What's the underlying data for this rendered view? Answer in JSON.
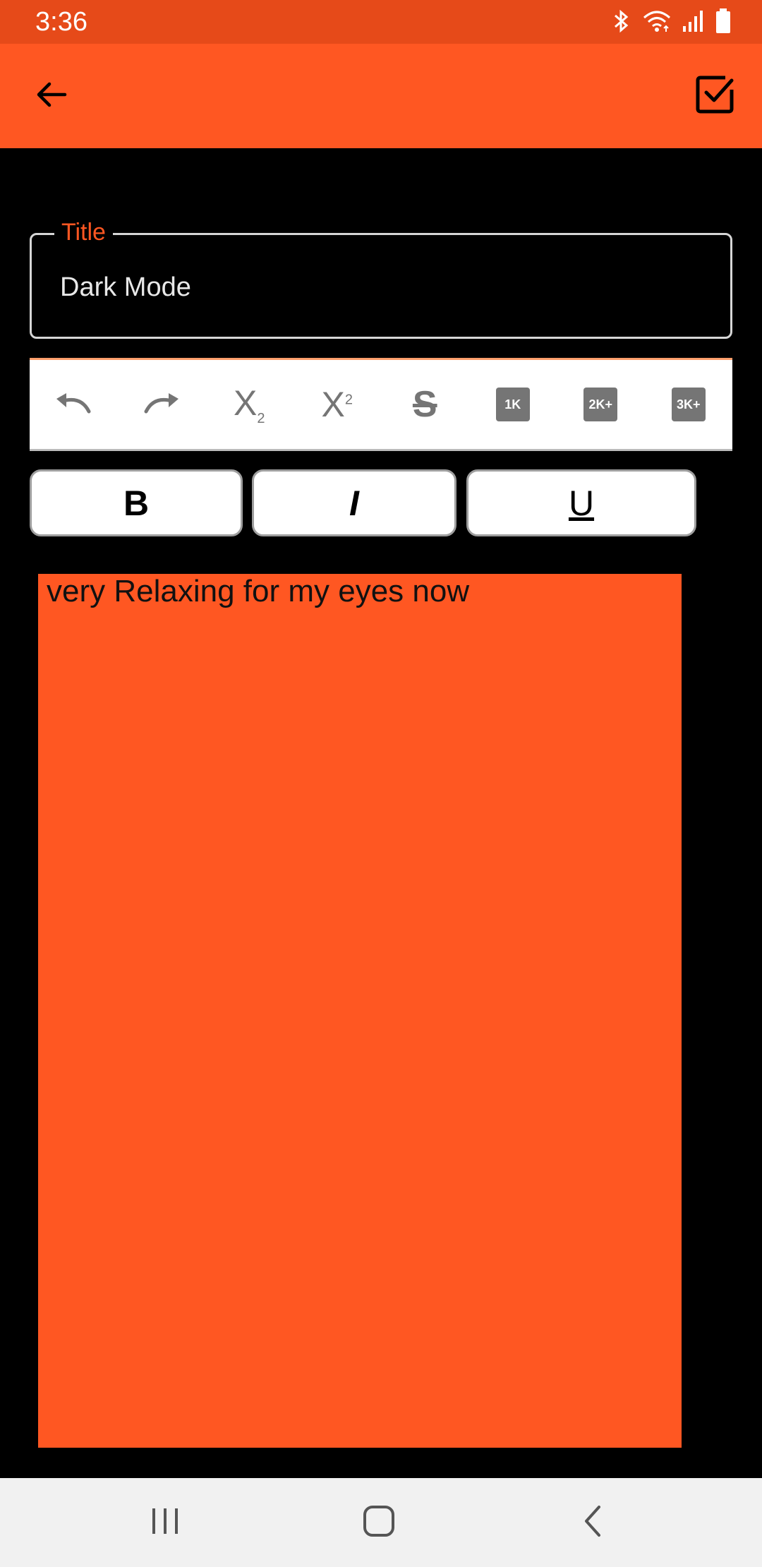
{
  "status_bar": {
    "time": "3:36",
    "icons": [
      "bluetooth-icon",
      "wifi-icon",
      "signal-icon",
      "battery-icon"
    ]
  },
  "app_bar": {
    "background": "#FF5722",
    "back_icon": "arrow-left-icon",
    "save_icon": "checkbox-check-icon"
  },
  "title_field": {
    "label": "Title",
    "value": "Dark Mode",
    "label_color": "#FF5722"
  },
  "toolbar": {
    "items": [
      {
        "name": "undo-icon"
      },
      {
        "name": "redo-icon"
      },
      {
        "name": "subscript-icon",
        "text": "X",
        "sub": "2"
      },
      {
        "name": "superscript-icon",
        "text": "X",
        "sup": "2"
      },
      {
        "name": "strikethrough-icon",
        "text": "S"
      },
      {
        "name": "size-1k-icon",
        "text": "1K"
      },
      {
        "name": "size-2k-icon",
        "text": "2K+"
      },
      {
        "name": "size-3k-icon",
        "text": "3K+"
      }
    ]
  },
  "format_buttons": {
    "bold": "B",
    "italic": "I",
    "underline": "U"
  },
  "editor": {
    "content": "very Relaxing for my eyes now",
    "background": "#FF5722"
  },
  "nav_bar": {
    "icons": [
      "recent-apps-icon",
      "home-icon",
      "back-icon"
    ]
  }
}
